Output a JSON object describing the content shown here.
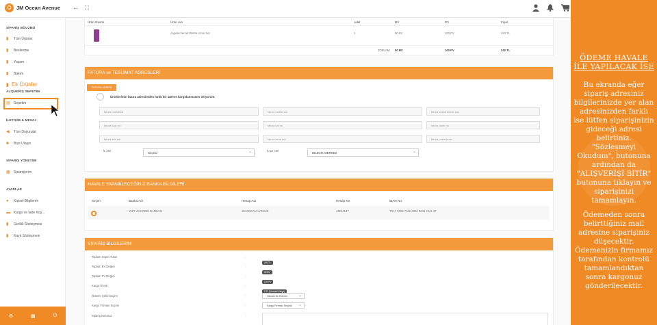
{
  "header": {
    "brand": "JM Ocean Avenue",
    "logo_letter": "O"
  },
  "sidebar": {
    "section1": "SİPARİŞ BÖLÜMÜ",
    "items1": [
      "Tüm Ürünler",
      "Beslenme",
      "Yaşam",
      "Bakım"
    ],
    "ek_label": "Ek Ürünler",
    "section2": "ALIŞVERİŞ SEPETİM",
    "sepetim": "Sepetim",
    "section3": "İLETİŞİM & MESAJ",
    "items3": [
      "Tüm Duyurular",
      "Bize Ulaşın"
    ],
    "section4": "SİPARİŞ YÖNETİMİ",
    "items4": [
      "Siparişlerim"
    ],
    "section5": "AYARLAR",
    "items5": [
      "Kişisel Bilgilerim",
      "Kargo ve İade Koş...",
      "Gizlilik Sözleşmesi",
      "Kayıt Sözleşmesi"
    ]
  },
  "cart": {
    "headers": [
      "Ürün Resmi",
      "Ürün Adı",
      "Adet",
      "BV",
      "PV",
      "Fiyat"
    ],
    "row": {
      "name": "Angela Secret Ekstra Uzun Set",
      "qty": "1",
      "bv": "50 BV",
      "pv": "100 PV",
      "price": "240 TL"
    },
    "total_label": "TOPLAM:",
    "total_bv": "50 BV",
    "total_pv": "100 PV",
    "total_price": "240 TL"
  },
  "address": {
    "title": "FATURA ve TESLİMAT ADRESLERİ",
    "tab": "FATURA ADRESİ",
    "checkbox_label": "Ürünlerimin fatura adresimden farklı bir adrese kargolanmasını istiyorum.",
    "placeholders": [
      "fatura mahallesi",
      "fatura cadde adı",
      "fatura sokak bulvar koy",
      "fatura kapı no",
      "fatura kat no",
      "fatura daire no",
      "fatura site adı",
      "fatura semt adı",
      "fatura posta kodu"
    ],
    "il_label": "İL ADI",
    "il_value": "Seçiniz",
    "ilce_label": "İLÇE ADI",
    "ilce_value": "BİLECİK MERKEZ"
  },
  "bank": {
    "title": "HAVALE YAPABİLECEĞİNİZ BANKA BİLGİLERİ",
    "headers": [
      "Seçim",
      "Banka Adı",
      "Hesap Adı",
      "Hesap No",
      "IBAN No"
    ],
    "row": {
      "bank": "YAPI VE KREDİ BANKASI",
      "account_name": "JM OCEAN AVENUE",
      "account_no": "43234147",
      "iban": "TR17 0006 7010 0000 0043 2341 47"
    }
  },
  "order": {
    "title": "SİPARİŞ BİLGİLERİM",
    "rows": [
      {
        "label": "Toplam Sepet Tutarı",
        "value": "240 TL"
      },
      {
        "label": "Toplam BV Değeri",
        "value": "50 BV"
      },
      {
        "label": "Toplam PV Değeri",
        "value": "100 PV"
      },
      {
        "label": "Kargo Ücreti",
        "value": "0 TL (Ücretsiz Kargo)"
      }
    ],
    "payment_label": "Ödeme Şekli Seçimi",
    "payment_value": "Havale ile Ödeme",
    "cargo_label": "Kargo Firması Seçimi",
    "cargo_value": "Kargo Firması Seçiniz",
    "note_label": "Sipariş Notunuz"
  },
  "panel": {
    "title": "ÖDEME HAVALE İLE YAPILACAK İSE",
    "text1": "Bu ekranda eğer sipariş adresiniz bilgilerinizde yer alan adresinizden farklı ise lütfen siparişinizin gideceği adresi belirtiniz. \"Sözleşmeyi Okudum\", butonuna ardından da \"ALIŞVERİŞİ BİTİR\" butonuna tıklayın ve siparişinizi tamamlayın.",
    "text2": "Ödemeden sonra belirttiğiniz mail adresine siparişiniz düşecektir. Ödemenizin firmamız tarafından kontrolü tamamlandıktan sonra kargonuz gönderilecektir."
  },
  "colors": {
    "accent": "#f08a24",
    "header": "#f39a3d"
  },
  "icons": [
    "back-arrow-icon",
    "fullscreen-icon",
    "user-icon",
    "bell-icon",
    "cart-icon",
    "gear-icon",
    "grid-icon",
    "power-icon"
  ]
}
